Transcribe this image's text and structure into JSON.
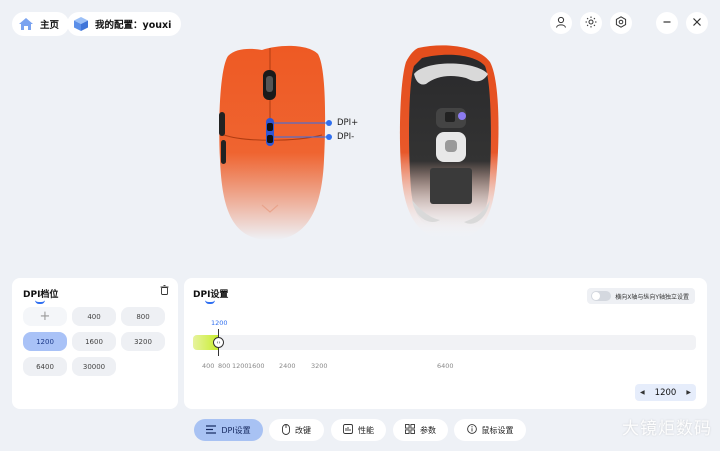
{
  "header": {
    "home_label": "主页",
    "config_label": "我的配置：youxi"
  },
  "mouse": {
    "dpi_plus": "DPI+",
    "dpi_minus": "DPI-",
    "body_color": "#ee5a24"
  },
  "dpi_levels": {
    "title": "DPI档位",
    "values": [
      "400",
      "800",
      "1200",
      "1600",
      "3200",
      "6400",
      "30000"
    ],
    "active": "1200"
  },
  "dpi_settings": {
    "title": "DPI设置",
    "toggle_label": "横向X轴与纵向Y轴独立设置",
    "current_dpi": "1200",
    "current_fraction": 0.047,
    "tick_labels": [
      "400",
      "800",
      "1200",
      "1600",
      "2400",
      "3200",
      "6400"
    ],
    "stepper_value": "1200"
  },
  "tabs": [
    {
      "label": "DPI设置",
      "icon": "sliders-icon"
    },
    {
      "label": "改键",
      "icon": "mouse-icon"
    },
    {
      "label": "性能",
      "icon": "chart-icon"
    },
    {
      "label": "参数",
      "icon": "grid-icon"
    },
    {
      "label": "鼠标设置",
      "icon": "info-icon"
    }
  ],
  "watermark": "大镜炬数码",
  "colors": {
    "accent": "#2f6ff0",
    "active_tab": "#a8c2f3",
    "slider_fill": "#c7ed2c"
  }
}
